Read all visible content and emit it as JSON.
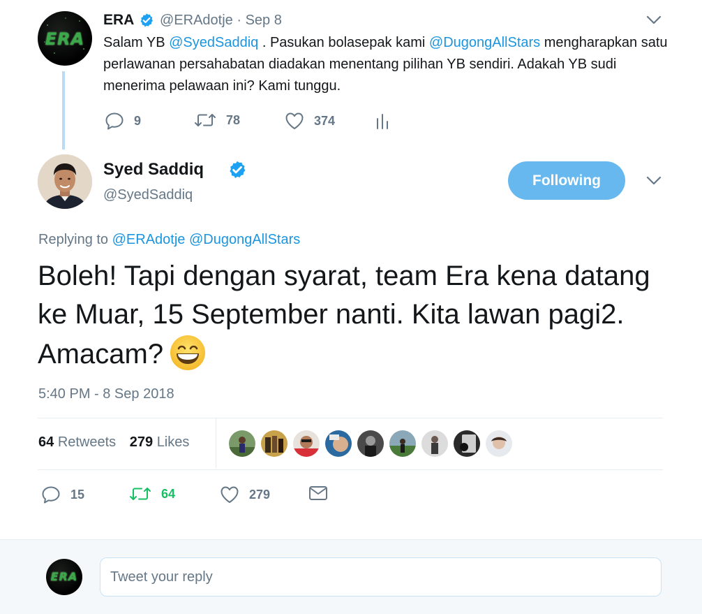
{
  "parent_tweet": {
    "author_name": "ERA",
    "avatar_logo_text": "ERA",
    "handle": "@ERAdotje",
    "date": "· Sep 8",
    "text_parts": [
      {
        "text": "Salam YB ",
        "mention": false
      },
      {
        "text": "@SyedSaddiq",
        "mention": true
      },
      {
        "text": " . Pasukan bolasepak kami ",
        "mention": false
      },
      {
        "text": "@DugongAllStars",
        "mention": true
      },
      {
        "text": " mengharapkan satu perlawanan persahabatan diadakan menentang pilihan YB sendiri. Adakah YB sudi menerima pelawaan ini? Kami tunggu.",
        "mention": false
      }
    ],
    "replies": "9",
    "retweets": "78",
    "likes": "374",
    "icons": [
      "reply-icon",
      "retweet-icon",
      "like-icon",
      "analytics-icon",
      "chevron-down-icon"
    ]
  },
  "main_tweet": {
    "author_name": "Syed Saddiq",
    "handle": "@SyedSaddiq",
    "follow_label": "Following",
    "replying_prefix": "Replying to",
    "replying_to": [
      "@ERAdotje",
      "@DugongAllStars"
    ],
    "text": "Boleh! Tapi dengan syarat, team Era kena datang ke Muar, 15 September nanti. Kita lawan pagi2. Amacam?",
    "emoji": "grinning-face-with-smiling-eyes",
    "timestamp": "5:40 PM - 8 Sep 2018",
    "stats": {
      "retweets_count": "64",
      "retweets_label": "Retweets",
      "likes_count": "279",
      "likes_label": "Likes"
    },
    "liker_avatar_count": 9,
    "actions": {
      "replies": "15",
      "retweets": "64",
      "likes": "279"
    },
    "icons": [
      "reply-icon",
      "retweet-icon",
      "like-icon",
      "direct-message-icon"
    ]
  },
  "reply_box": {
    "avatar_logo_text": "ERA",
    "placeholder": "Tweet your reply"
  },
  "colors": {
    "link_blue": "#1b95e0",
    "muted": "#657786",
    "follow_button": "#66b8ee",
    "retweet_green": "#17bf63",
    "thread_line": "#b9dbf3",
    "verified_blue": "#1da1f2"
  }
}
